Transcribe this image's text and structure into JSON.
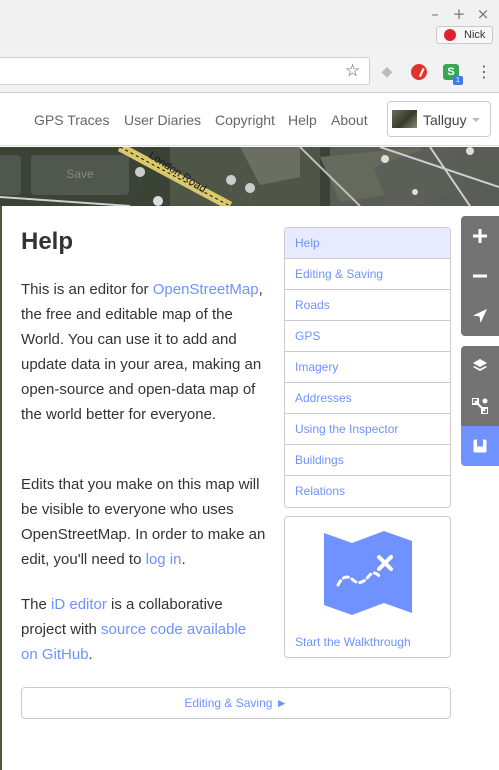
{
  "browser": {
    "window_buttons": [
      "–",
      "+",
      "×"
    ],
    "profile_name": "Nick",
    "extensions": [
      "dropbox-icon",
      "red-extension-icon",
      "s-extension-icon"
    ],
    "s_extension_letter": "S",
    "s_extension_badge": "1"
  },
  "nav": {
    "links": [
      "GPS Traces",
      "User Diaries",
      "Copyright",
      "Help",
      "About"
    ],
    "user": "Tallguy"
  },
  "map": {
    "save_label": "Save",
    "street_label": "London Road"
  },
  "help": {
    "title": "Help",
    "para1": {
      "before": "This is an editor for ",
      "link": "OpenStreetMap",
      "after": ", the free and editable map of the World. You can use it to add and update data in your area, making an open-source and open-data map of the world better for everyone."
    },
    "para2": {
      "before": "Edits that you make on this map will be visible to everyone who uses OpenStreetMap. In order to make an edit, you'll need to ",
      "link": "log in",
      "after": "."
    },
    "para3": {
      "before": "The ",
      "link1": "iD editor",
      "middle": " is a collaborative project with ",
      "link2": "source code available on GitHub",
      "after": "."
    },
    "toc": [
      "Help",
      "Editing & Saving",
      "Roads",
      "GPS",
      "Imagery",
      "Addresses",
      "Using the Inspector",
      "Buildings",
      "Relations"
    ],
    "toc_active": "Help",
    "walkthrough_label": "Start the Walkthrough",
    "next_button": "Editing & Saving ►"
  },
  "map_controls": [
    "zoom-in-icon",
    "zoom-out-icon",
    "geolocate-icon",
    "layers-icon",
    "map-data-icon",
    "help-icon"
  ],
  "colors": {
    "link": "#7092ff",
    "active_control": "#7092ff",
    "toc_active_bg": "#e8ebff"
  }
}
